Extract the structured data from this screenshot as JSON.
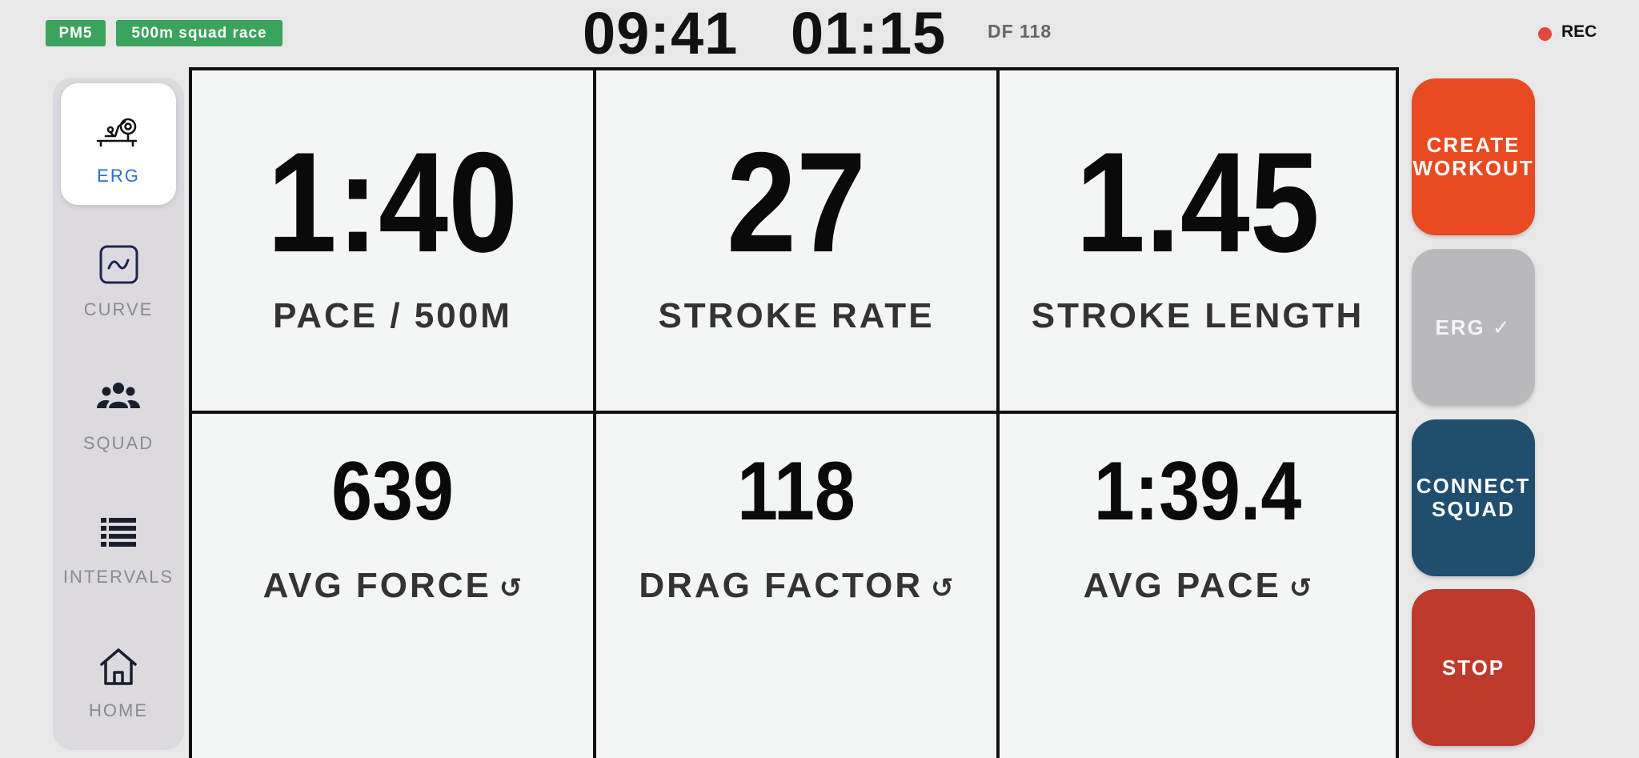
{
  "header": {
    "device_badge": "PM5",
    "workout_badge": "500m squad race",
    "clock_time": "09:41",
    "elapsed_time": "01:15",
    "df_label": "DF 118",
    "rec_label": "REC"
  },
  "sidebar": {
    "items": [
      {
        "label": "ERG",
        "icon": "rower-icon",
        "active": true
      },
      {
        "label": "CURVE",
        "icon": "curve-icon",
        "active": false
      },
      {
        "label": "SQUAD",
        "icon": "group-icon",
        "active": false
      },
      {
        "label": "INTERVALS",
        "icon": "list-icon",
        "active": false
      },
      {
        "label": "HOME",
        "icon": "home-icon",
        "active": false
      }
    ]
  },
  "metrics": [
    {
      "value": "1:40",
      "label": "PACE / 500M",
      "resettable": false
    },
    {
      "value": "27",
      "label": "STROKE RATE",
      "resettable": false
    },
    {
      "value": "1.45",
      "label": "STROKE LENGTH",
      "resettable": false
    },
    {
      "value": "639",
      "label": "AVG FORCE",
      "resettable": true
    },
    {
      "value": "118",
      "label": "DRAG FACTOR",
      "resettable": true
    },
    {
      "value": "1:39.4",
      "label": "AVG PACE",
      "resettable": true
    }
  ],
  "reset_glyph": "↺",
  "actions": {
    "create_workout": "CREATE WORKOUT",
    "erg": "ERG ✓",
    "connect_squad": "CONNECT SQUAD",
    "stop": "STOP"
  },
  "colors": {
    "badge_green": "#3aa35c",
    "rec_red": "#e2493f",
    "active_blue": "#2a6fcf",
    "create_orange": "#e84a21",
    "erg_grey": "#b9b8bd",
    "connect_navy": "#1f4e6e",
    "stop_red": "#bd3a2d"
  }
}
